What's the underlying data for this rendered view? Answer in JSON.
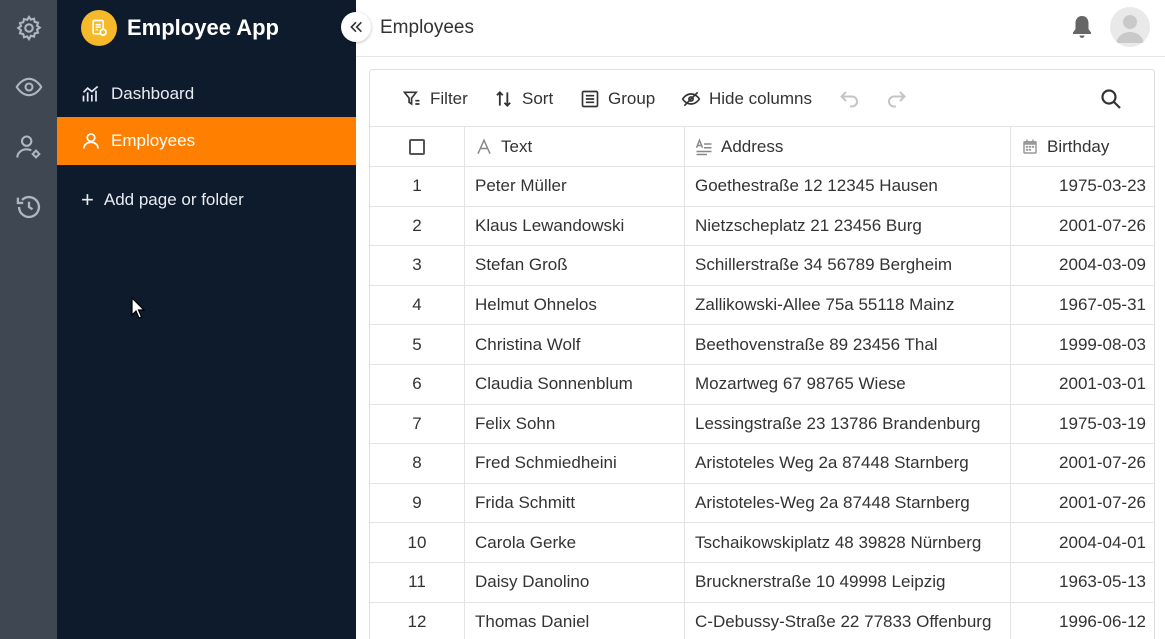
{
  "app": {
    "title": "Employee App",
    "accent": "#ff8000",
    "logo_color": "#f5b92a"
  },
  "rail": [
    "gear-icon",
    "eye-icon",
    "user-settings-icon",
    "history-icon"
  ],
  "sidebar": {
    "items": [
      {
        "label": "Dashboard",
        "icon": "chart-icon",
        "active": false
      },
      {
        "label": "Employees",
        "icon": "user-icon",
        "active": true
      }
    ],
    "add_page_label": "Add page or folder"
  },
  "header": {
    "title": "Employees"
  },
  "toolbar": {
    "filter": "Filter",
    "sort": "Sort",
    "group": "Group",
    "hide_columns": "Hide columns"
  },
  "table": {
    "columns": [
      "Text",
      "Address",
      "Birthday"
    ],
    "rows": [
      {
        "n": "1",
        "text": "Peter Müller",
        "address": "Goethestraße 12 12345 Hausen",
        "birthday": "1975-03-23"
      },
      {
        "n": "2",
        "text": "Klaus Lewandowski",
        "address": "Nietzscheplatz 21 23456 Burg",
        "birthday": "2001-07-26"
      },
      {
        "n": "3",
        "text": "Stefan Groß",
        "address": "Schillerstraße 34 56789 Bergheim",
        "birthday": "2004-03-09"
      },
      {
        "n": "4",
        "text": "Helmut Ohnelos",
        "address": "Zallikowski-Allee 75a 55118 Mainz",
        "birthday": "1967-05-31"
      },
      {
        "n": "5",
        "text": "Christina Wolf",
        "address": "Beethovenstraße 89 23456 Thal",
        "birthday": "1999-08-03"
      },
      {
        "n": "6",
        "text": "Claudia Sonnenblum",
        "address": "Mozartweg 67 98765 Wiese",
        "birthday": "2001-03-01"
      },
      {
        "n": "7",
        "text": "Felix Sohn",
        "address": "Lessingstraße 23 13786 Brandenburg",
        "birthday": "1975-03-19"
      },
      {
        "n": "8",
        "text": "Fred Schmiedheini",
        "address": "Aristoteles Weg 2a 87448 Starnberg",
        "birthday": "2001-07-26"
      },
      {
        "n": "9",
        "text": "Frida Schmitt",
        "address": "Aristoteles-Weg 2a 87448 Starnberg",
        "birthday": "2001-07-26"
      },
      {
        "n": "10",
        "text": "Carola Gerke",
        "address": "Tschaikowskiplatz 48 39828 Nürnberg",
        "birthday": "2004-04-01"
      },
      {
        "n": "11",
        "text": "Daisy Danolino",
        "address": "Brucknerstraße 10 49998 Leipzig",
        "birthday": "1963-05-13"
      },
      {
        "n": "12",
        "text": "Thomas Daniel",
        "address": "C-Debussy-Straße 22 77833 Offenburg",
        "birthday": "1996-06-12"
      }
    ]
  }
}
